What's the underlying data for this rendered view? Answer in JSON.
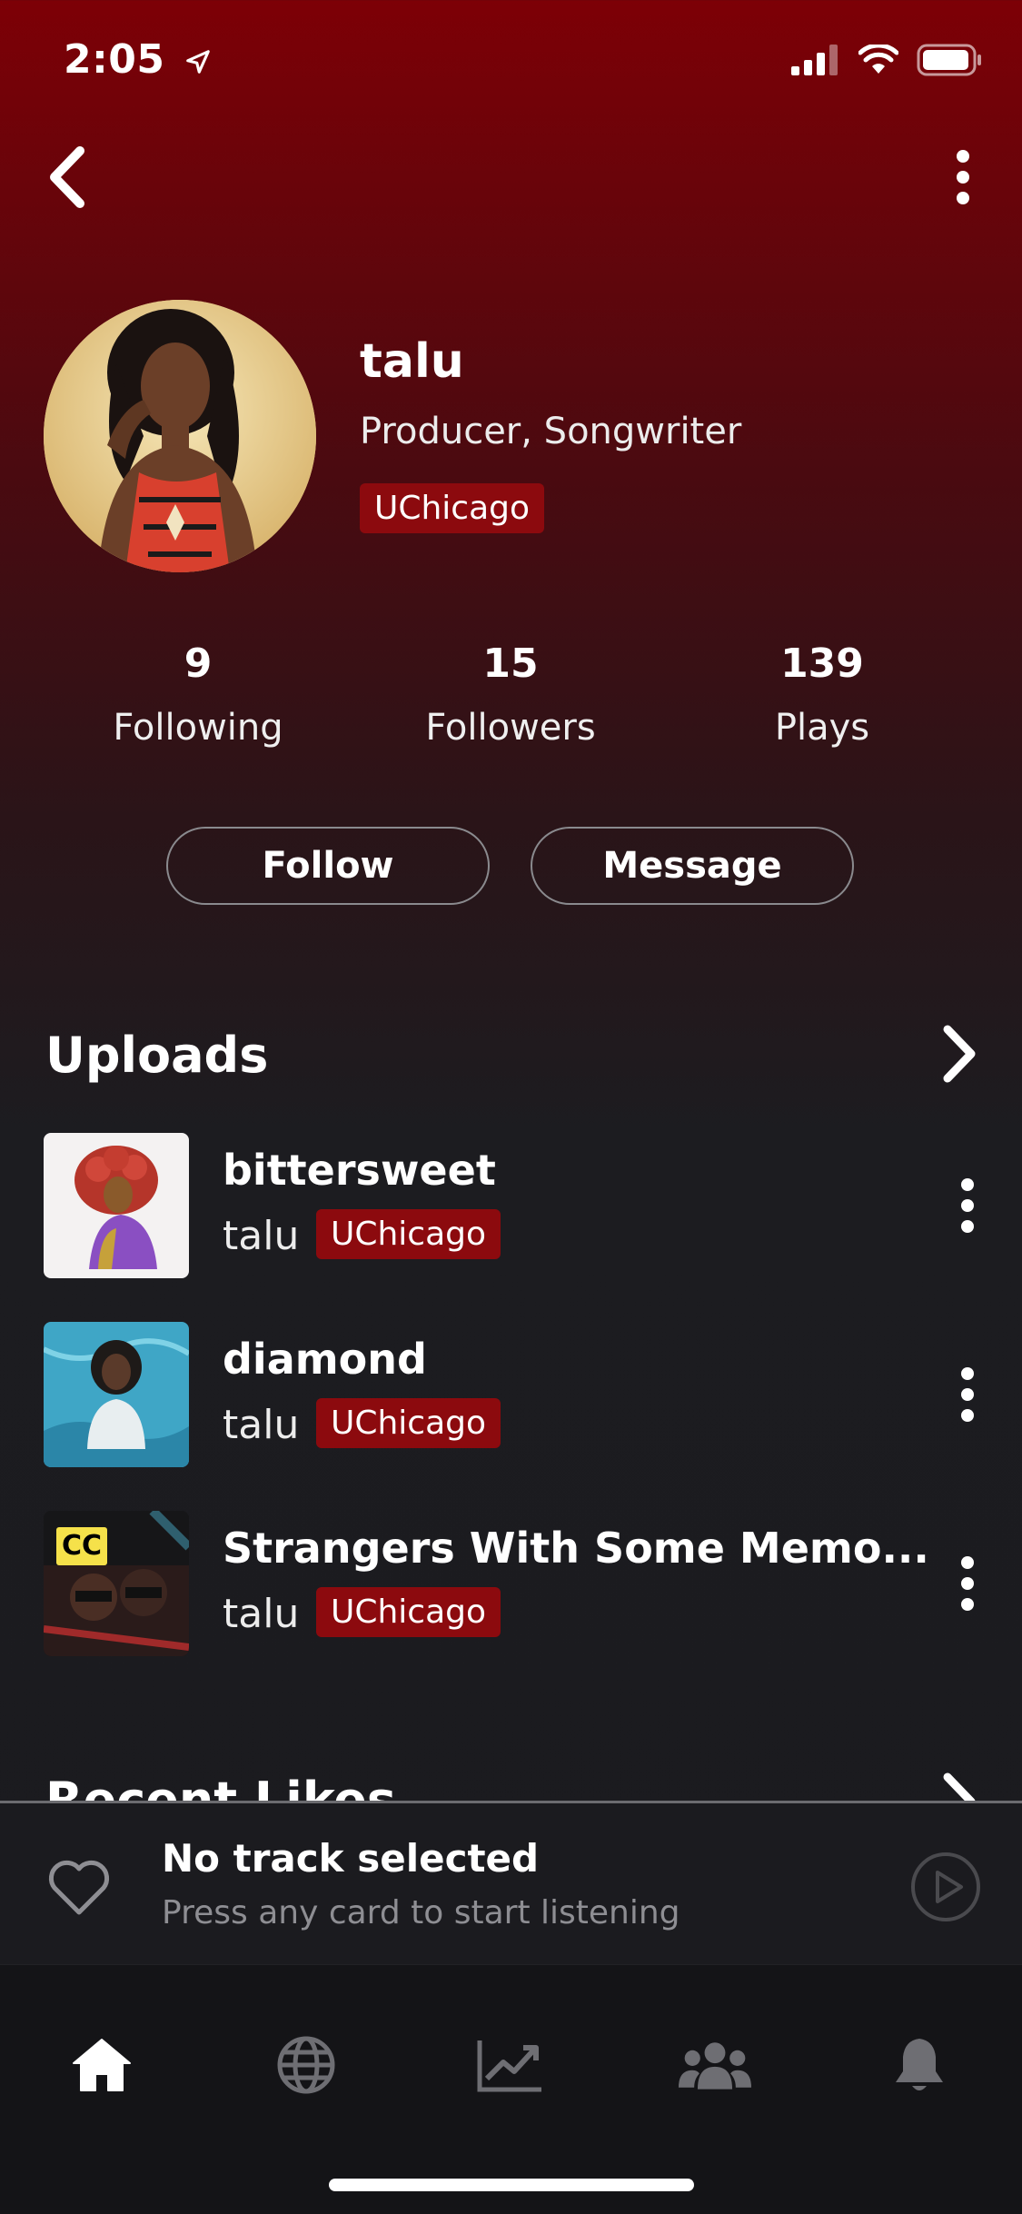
{
  "status_bar": {
    "time": "2:05"
  },
  "profile": {
    "name": "talu",
    "role": "Producer, Songwriter",
    "school_tag": "UChicago"
  },
  "stats": [
    {
      "value": "9",
      "label": "Following"
    },
    {
      "value": "15",
      "label": "Followers"
    },
    {
      "value": "139",
      "label": "Plays"
    }
  ],
  "actions": {
    "follow_label": "Follow",
    "message_label": "Message"
  },
  "uploads": {
    "title": "Uploads",
    "items": [
      {
        "title": "bittersweet",
        "artist": "talu",
        "tag": "UChicago"
      },
      {
        "title": "diamond",
        "artist": "talu",
        "tag": "UChicago"
      },
      {
        "title": "Strangers With Some Memo...",
        "artist": "talu",
        "tag": "UChicago",
        "badge": "CC"
      }
    ]
  },
  "recent_likes": {
    "title": "Recent Likes"
  },
  "player": {
    "title": "No track selected",
    "subtitle": "Press any card to start listening"
  },
  "tabbar": {
    "items": [
      "home-icon",
      "globe-icon",
      "trending-icon",
      "community-icon",
      "bell-icon"
    ],
    "active": "home-icon"
  },
  "colors": {
    "accent": "#8c0a0e",
    "background": "#1a1a1e"
  }
}
